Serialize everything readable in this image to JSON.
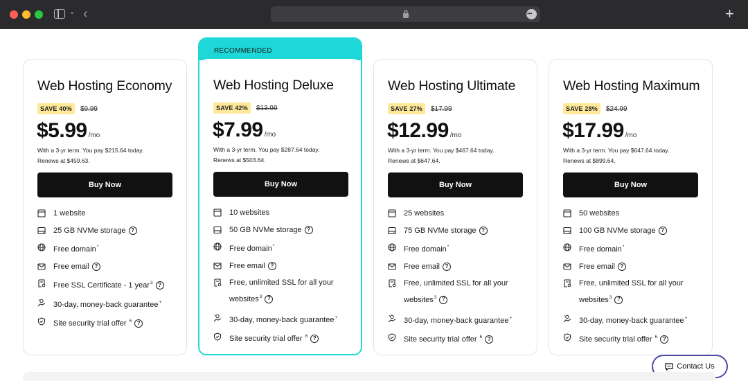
{
  "browser": {
    "icons": [
      "sidebar-icon",
      "chevron-down-icon",
      "back-arrow-icon",
      "lock-icon",
      "more-icon",
      "plus-icon"
    ]
  },
  "recommended_label": "RECOMMENDED",
  "plans": [
    {
      "title": "Web Hosting Economy",
      "save": "SAVE 40%",
      "old_price": "$9.99",
      "price": "$5.99",
      "per": "/mo",
      "term_line1": "With a 3-yr term. You pay $215.64 today.",
      "term_line2": "Renews at $459.63.",
      "buy": "Buy Now",
      "features": {
        "websites": "1 website",
        "storage": "25 GB NVMe storage",
        "domain": "Free domain",
        "email": "Free email",
        "ssl": "Free SSL Certificate - 1 year",
        "ssl_sup": "3",
        "guarantee": "30-day, money-back guarantee",
        "security": "Site security trial offer",
        "security_sup": "6"
      }
    },
    {
      "title": "Web Hosting Deluxe",
      "save": "SAVE 42%",
      "old_price": "$13.99",
      "price": "$7.99",
      "per": "/mo",
      "term_line1": "With a 3-yr term. You pay $287.64 today.",
      "term_line2": "Renews at $503.64.",
      "buy": "Buy Now",
      "features": {
        "websites": "10 websites",
        "storage": "50 GB NVMe storage",
        "domain": "Free domain",
        "email": "Free email",
        "ssl_line1": "Free, unlimited SSL for all your",
        "ssl_line2": "websites",
        "ssl_sup": "3",
        "guarantee": "30-day, money-back guarantee",
        "security": "Site security trial offer",
        "security_sup": "6"
      }
    },
    {
      "title": "Web Hosting Ultimate",
      "save": "SAVE 27%",
      "old_price": "$17.99",
      "price": "$12.99",
      "per": "/mo",
      "term_line1": "With a 3-yr term. You pay $467.64 today.",
      "term_line2": "Renews at $647.64.",
      "buy": "Buy Now",
      "features": {
        "websites": "25 websites",
        "storage": "75 GB NVMe storage",
        "domain": "Free domain",
        "email": "Free email",
        "ssl_line1": "Free, unlimited SSL for all your",
        "ssl_line2": "websites",
        "ssl_sup": "3",
        "guarantee": "30-day, money-back guarantee",
        "security": "Site security trial offer",
        "security_sup": "6"
      }
    },
    {
      "title": "Web Hosting Maximum",
      "save": "SAVE 28%",
      "old_price": "$24.99",
      "price": "$17.99",
      "per": "/mo",
      "term_line1": "With a 3-yr term. You pay $647.64 today.",
      "term_line2": "Renews at $899.64.",
      "buy": "Buy Now",
      "features": {
        "websites": "50 websites",
        "storage": "100 GB NVMe storage",
        "domain": "Free domain",
        "email": "Free email",
        "ssl_line1": "Free, unlimited SSL for all your",
        "ssl_line2": "websites",
        "ssl_sup": "3",
        "guarantee": "30-day, money-back guarantee",
        "security": "Site security trial offer",
        "security_sup": "6"
      }
    }
  ],
  "contact": {
    "label": "Contact Us"
  },
  "colors": {
    "accent": "#1ed7d8",
    "badge": "#ffe998",
    "button": "#111111",
    "contact_border": "#4b48a8"
  }
}
